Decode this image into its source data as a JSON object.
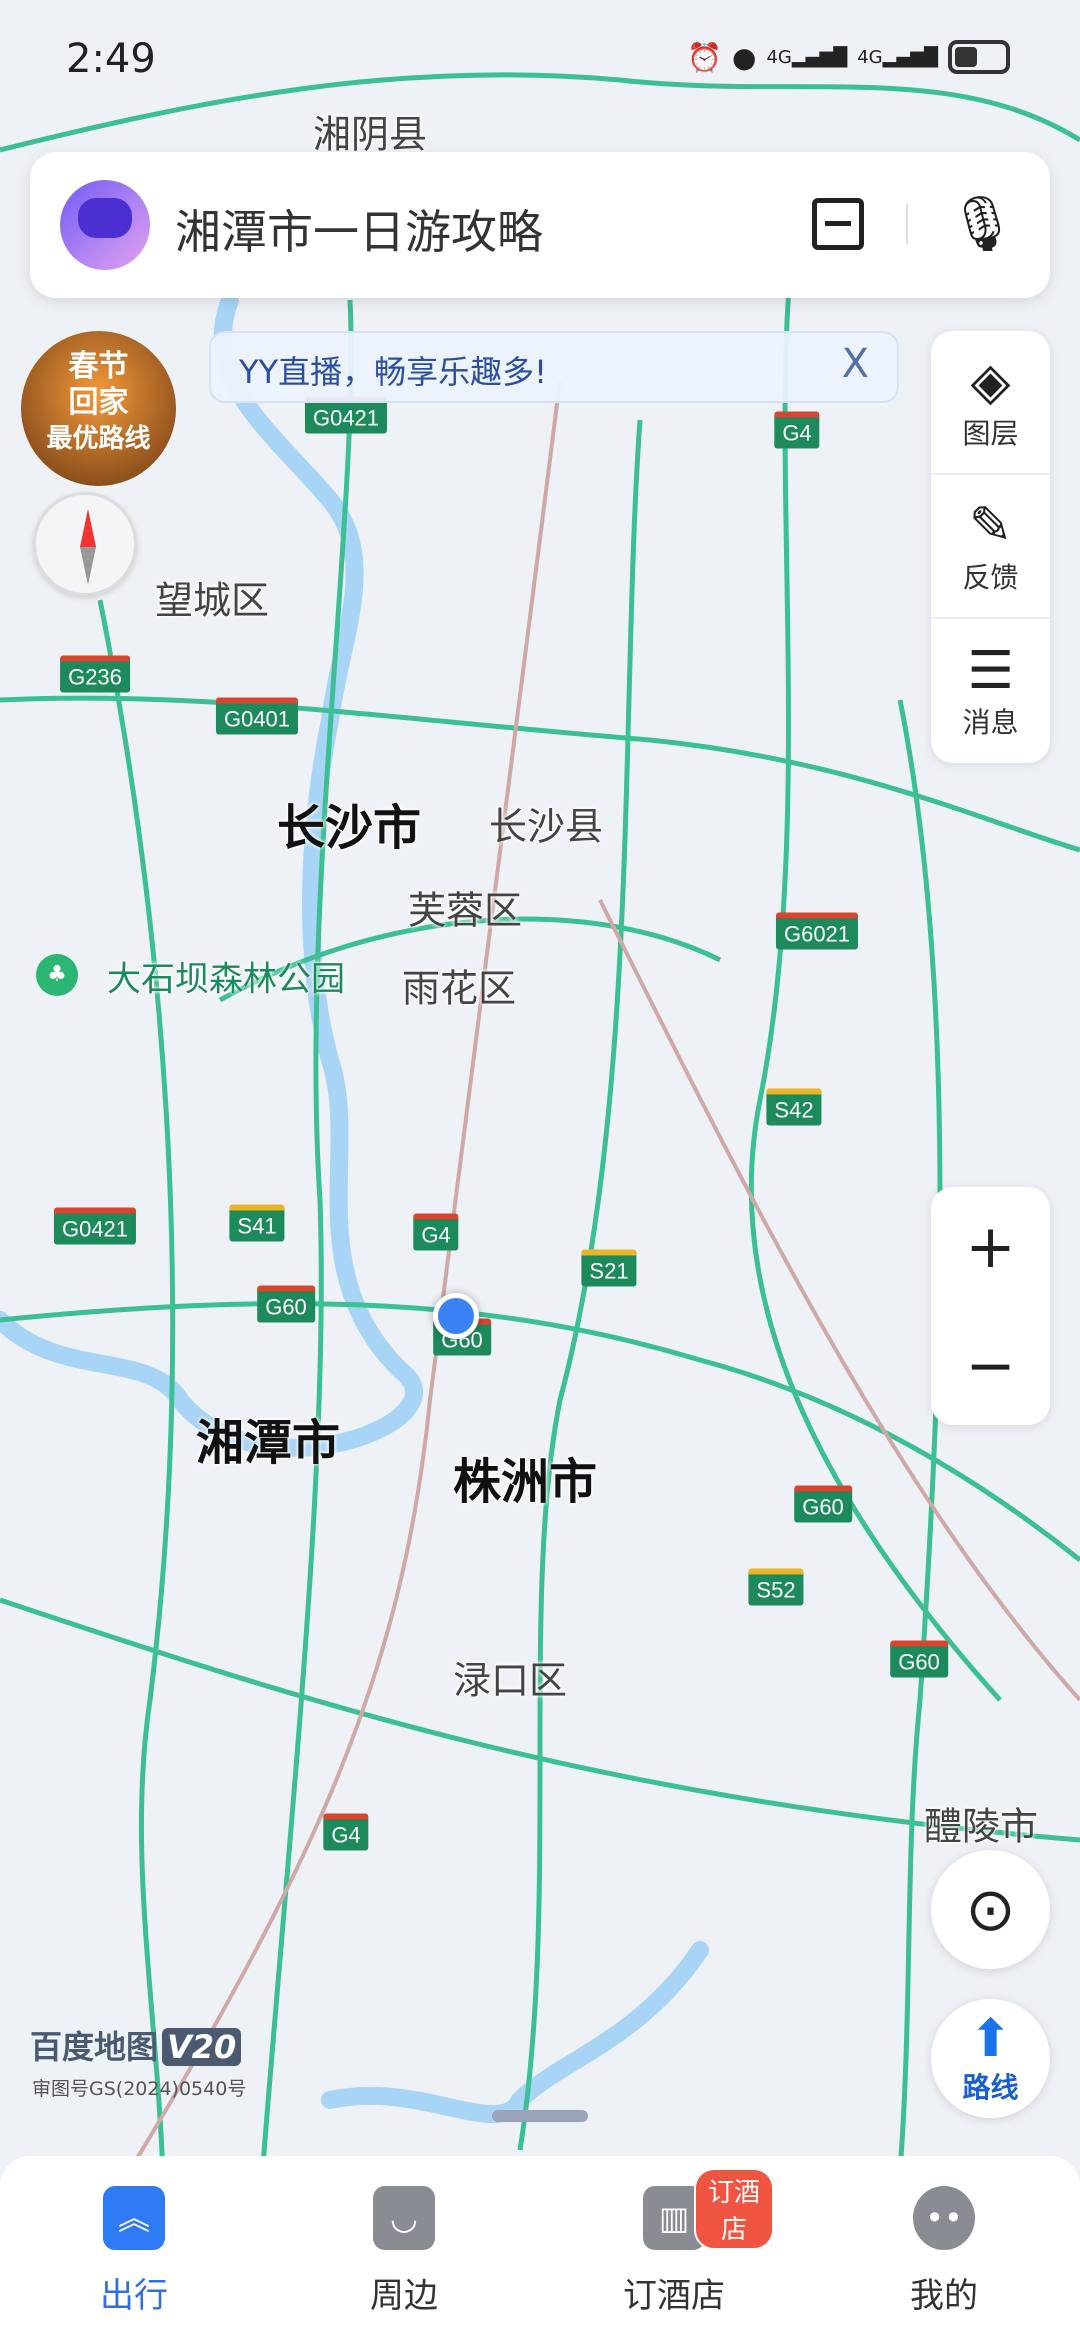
{
  "status": {
    "time": "2:49",
    "network1": "4G",
    "network2": "4G"
  },
  "search": {
    "text": "湘潭市一日游攻略"
  },
  "banner": {
    "text": "YY直播，畅享乐趣多!",
    "close": "X"
  },
  "promo": {
    "line1": "春节",
    "line2": "回家",
    "line3": "最优路线"
  },
  "side_panel": [
    {
      "icon": "layers-icon",
      "label": "图层"
    },
    {
      "icon": "feedback-icon",
      "label": "反馈"
    },
    {
      "icon": "message-icon",
      "label": "消息"
    }
  ],
  "zoom": {
    "in": "+",
    "out": "−"
  },
  "route": {
    "label": "路线"
  },
  "map": {
    "labels": [
      "湘阴县",
      "望城区",
      "长沙市",
      "长沙县",
      "芙蓉区",
      "雨花区",
      "大石坝森林公园",
      "湘潭市",
      "株洲市",
      "渌口区",
      "醴陵市"
    ],
    "shields": [
      "G0421",
      "G4",
      "G236",
      "G0401",
      "G6021",
      "S42",
      "G0421",
      "S41",
      "G4",
      "S21",
      "G60",
      "G60",
      "G60",
      "S52",
      "G60",
      "G4"
    ]
  },
  "brand": {
    "name": "百度地图",
    "version": "V20",
    "approval": "审图号GS(2024)0540号"
  },
  "nav": [
    {
      "label": "出行",
      "active": true
    },
    {
      "label": "周边"
    },
    {
      "label": "订酒店",
      "badge": "订酒店"
    },
    {
      "label": "我的"
    }
  ],
  "colors": {
    "accent": "#2f7af5",
    "highway": "#1d8a5c",
    "badge": "#f05542"
  }
}
